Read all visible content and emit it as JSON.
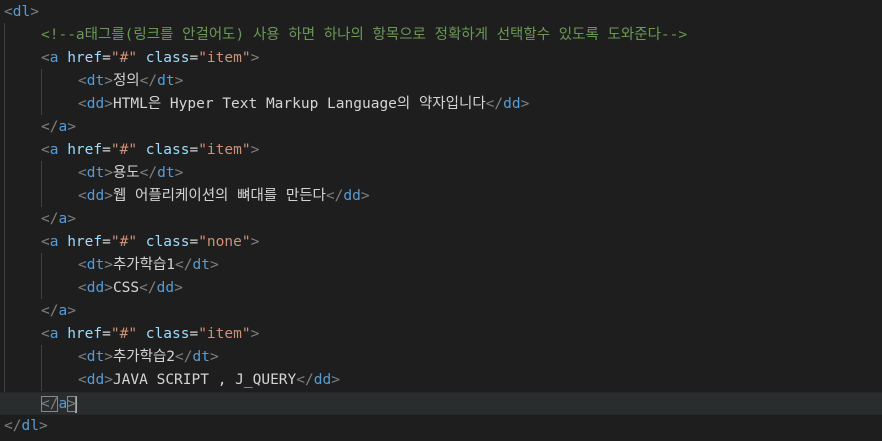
{
  "lines": [
    {
      "indent": 0,
      "parts": [
        [
          "punct",
          "<"
        ],
        [
          "tag",
          "dl"
        ],
        [
          "punct",
          ">"
        ]
      ]
    },
    {
      "indent": 1,
      "parts": [
        [
          "cmt",
          "<!--a태그를(링크를 안걸어도) 사용 하면 하나의 항목으로 정확하게 선택할수 있도록 도와준다-->"
        ]
      ]
    },
    {
      "indent": 1,
      "parts": [
        [
          "punct",
          "<"
        ],
        [
          "tag",
          "a"
        ],
        [
          "txt",
          " "
        ],
        [
          "attr",
          "href"
        ],
        [
          "txt",
          "="
        ],
        [
          "str",
          "\"#\""
        ],
        [
          "txt",
          " "
        ],
        [
          "attr",
          "class"
        ],
        [
          "txt",
          "="
        ],
        [
          "str",
          "\"item\""
        ],
        [
          "punct",
          ">"
        ]
      ]
    },
    {
      "indent": 2,
      "parts": [
        [
          "punct",
          "<"
        ],
        [
          "tag",
          "dt"
        ],
        [
          "punct",
          ">"
        ],
        [
          "txt",
          "정의"
        ],
        [
          "punct",
          "</"
        ],
        [
          "tag",
          "dt"
        ],
        [
          "punct",
          ">"
        ]
      ]
    },
    {
      "indent": 2,
      "parts": [
        [
          "punct",
          "<"
        ],
        [
          "tag",
          "dd"
        ],
        [
          "punct",
          ">"
        ],
        [
          "txt",
          "HTML은 Hyper Text Markup Language의 약자입니다"
        ],
        [
          "punct",
          "</"
        ],
        [
          "tag",
          "dd"
        ],
        [
          "punct",
          ">"
        ]
      ]
    },
    {
      "indent": 1,
      "parts": [
        [
          "punct",
          "</"
        ],
        [
          "tag",
          "a"
        ],
        [
          "punct",
          ">"
        ]
      ]
    },
    {
      "indent": 1,
      "parts": [
        [
          "punct",
          "<"
        ],
        [
          "tag",
          "a"
        ],
        [
          "txt",
          " "
        ],
        [
          "attr",
          "href"
        ],
        [
          "txt",
          "="
        ],
        [
          "str",
          "\"#\""
        ],
        [
          "txt",
          " "
        ],
        [
          "attr",
          "class"
        ],
        [
          "txt",
          "="
        ],
        [
          "str",
          "\"item\""
        ],
        [
          "punct",
          ">"
        ]
      ]
    },
    {
      "indent": 2,
      "parts": [
        [
          "punct",
          "<"
        ],
        [
          "tag",
          "dt"
        ],
        [
          "punct",
          ">"
        ],
        [
          "txt",
          "용도"
        ],
        [
          "punct",
          "</"
        ],
        [
          "tag",
          "dt"
        ],
        [
          "punct",
          ">"
        ]
      ]
    },
    {
      "indent": 2,
      "parts": [
        [
          "punct",
          "<"
        ],
        [
          "tag",
          "dd"
        ],
        [
          "punct",
          ">"
        ],
        [
          "txt",
          "웹 어플리케이션의 뼈대를 만든다"
        ],
        [
          "punct",
          "</"
        ],
        [
          "tag",
          "dd"
        ],
        [
          "punct",
          ">"
        ]
      ]
    },
    {
      "indent": 1,
      "parts": [
        [
          "punct",
          "</"
        ],
        [
          "tag",
          "a"
        ],
        [
          "punct",
          ">"
        ]
      ]
    },
    {
      "indent": 1,
      "parts": [
        [
          "punct",
          "<"
        ],
        [
          "tag",
          "a"
        ],
        [
          "txt",
          " "
        ],
        [
          "attr",
          "href"
        ],
        [
          "txt",
          "="
        ],
        [
          "str",
          "\"#\""
        ],
        [
          "txt",
          " "
        ],
        [
          "attr",
          "class"
        ],
        [
          "txt",
          "="
        ],
        [
          "str",
          "\"none\""
        ],
        [
          "punct",
          ">"
        ]
      ]
    },
    {
      "indent": 2,
      "parts": [
        [
          "punct",
          "<"
        ],
        [
          "tag",
          "dt"
        ],
        [
          "punct",
          ">"
        ],
        [
          "txt",
          "추가학습1"
        ],
        [
          "punct",
          "</"
        ],
        [
          "tag",
          "dt"
        ],
        [
          "punct",
          ">"
        ]
      ]
    },
    {
      "indent": 2,
      "parts": [
        [
          "punct",
          "<"
        ],
        [
          "tag",
          "dd"
        ],
        [
          "punct",
          ">"
        ],
        [
          "txt",
          "CSS"
        ],
        [
          "punct",
          "</"
        ],
        [
          "tag",
          "dd"
        ],
        [
          "punct",
          ">"
        ]
      ]
    },
    {
      "indent": 1,
      "parts": [
        [
          "punct",
          "</"
        ],
        [
          "tag",
          "a"
        ],
        [
          "punct",
          ">"
        ]
      ]
    },
    {
      "indent": 1,
      "parts": [
        [
          "punct",
          "<"
        ],
        [
          "tag",
          "a"
        ],
        [
          "txt",
          " "
        ],
        [
          "attr",
          "href"
        ],
        [
          "txt",
          "="
        ],
        [
          "str",
          "\"#\""
        ],
        [
          "txt",
          " "
        ],
        [
          "attr",
          "class"
        ],
        [
          "txt",
          "="
        ],
        [
          "str",
          "\"item\""
        ],
        [
          "punct",
          ">"
        ]
      ]
    },
    {
      "indent": 2,
      "parts": [
        [
          "punct",
          "<"
        ],
        [
          "tag",
          "dt"
        ],
        [
          "punct",
          ">"
        ],
        [
          "txt",
          "추가학습2"
        ],
        [
          "punct",
          "</"
        ],
        [
          "tag",
          "dt"
        ],
        [
          "punct",
          ">"
        ]
      ]
    },
    {
      "indent": 2,
      "parts": [
        [
          "punct",
          "<"
        ],
        [
          "tag",
          "dd"
        ],
        [
          "punct",
          ">"
        ],
        [
          "txt",
          "JAVA SCRIPT , J_QUERY"
        ],
        [
          "punct",
          "</"
        ],
        [
          "tag",
          "dd"
        ],
        [
          "punct",
          ">"
        ]
      ]
    },
    {
      "indent": 1,
      "current": true,
      "parts": [
        [
          "punct match",
          "</"
        ],
        [
          "tag",
          "a"
        ],
        [
          "punct match",
          ">"
        ],
        [
          "cursor",
          ""
        ]
      ]
    },
    {
      "indent": 0,
      "parts": [
        [
          "punct",
          "</"
        ],
        [
          "tag",
          "dl"
        ],
        [
          "punct",
          ">"
        ]
      ]
    }
  ],
  "theme": {
    "background": "#1e1e1e",
    "tag": "#569cd6",
    "attr": "#9cdcfe",
    "string": "#ce9178",
    "comment": "#6a9955",
    "text": "#d4d4d4",
    "punct": "#808080"
  }
}
